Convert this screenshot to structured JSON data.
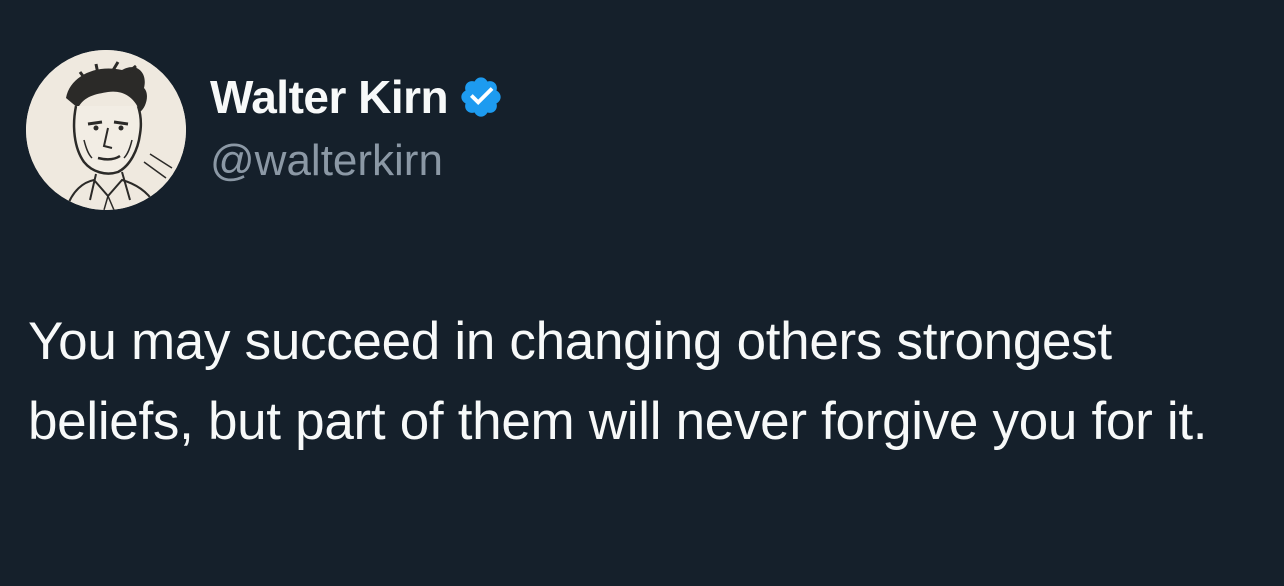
{
  "author": {
    "display_name": "Walter Kirn",
    "handle": "@walterkirn",
    "verified": true,
    "avatar_icon": "sketch-portrait-avatar"
  },
  "tweet": {
    "text": "You may succeed in changing others strongest beliefs, but part of them will never forgive you for it."
  },
  "colors": {
    "background": "#15202b",
    "primary_text": "#f7f9f9",
    "secondary_text": "#8b98a5",
    "verified_badge": "#1d9bf0"
  }
}
